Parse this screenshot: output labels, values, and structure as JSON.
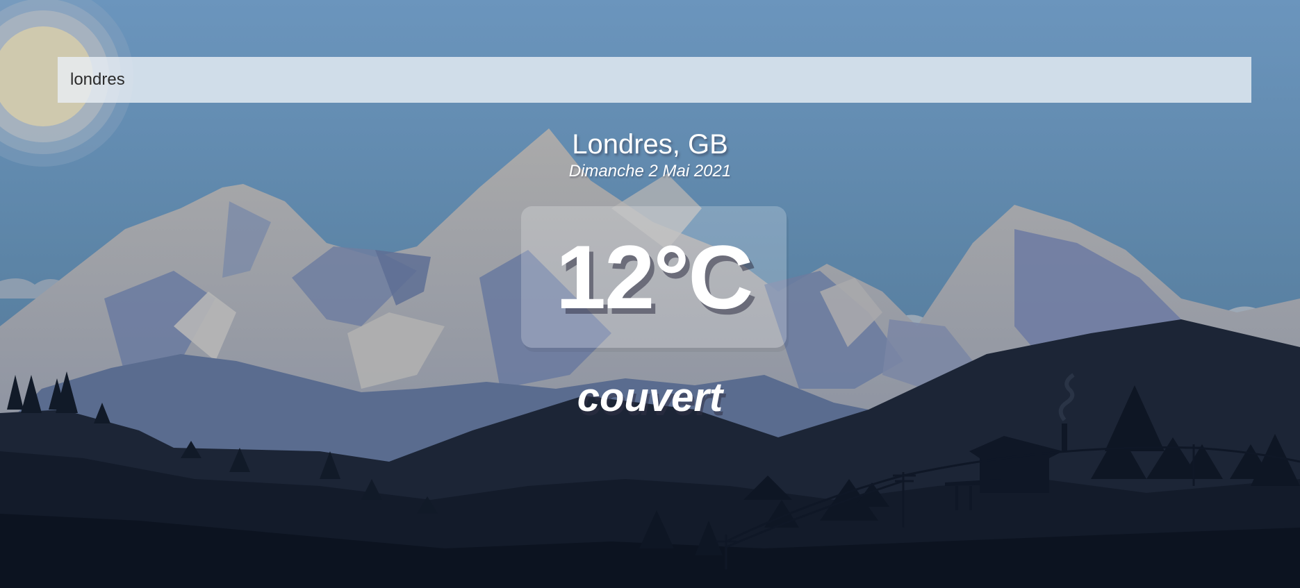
{
  "search": {
    "value": "londres",
    "placeholder": ""
  },
  "location": {
    "city": "Londres, GB",
    "date": "Dimanche 2 Mai 2021"
  },
  "weather": {
    "temperature": "12°C",
    "description": "couvert"
  },
  "background": {
    "scene": "mountain landscape with sun, forest and cabin",
    "sky_color": "#6a93ba"
  }
}
